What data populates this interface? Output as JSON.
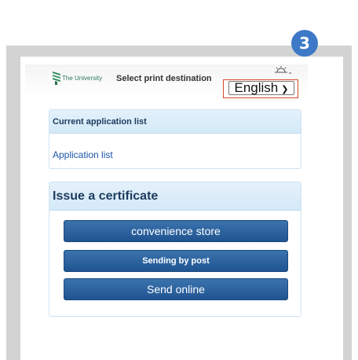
{
  "step": {
    "number": "3",
    "color": "#3d79c6"
  },
  "header": {
    "logo_text": "The University",
    "title": "Select print destination",
    "language": {
      "selected": "English"
    }
  },
  "current_applications": {
    "heading": "Current application list",
    "link": "Application list"
  },
  "issue_certificate": {
    "heading": "Issue a certificate",
    "buttons": [
      {
        "label": "convenience store"
      },
      {
        "label": "Sending by post"
      },
      {
        "label": "Send online"
      }
    ]
  },
  "colors": {
    "button": "#2a5f9e",
    "highlight_border": "#d04a2a",
    "panel_header": "#d9ecf9"
  }
}
